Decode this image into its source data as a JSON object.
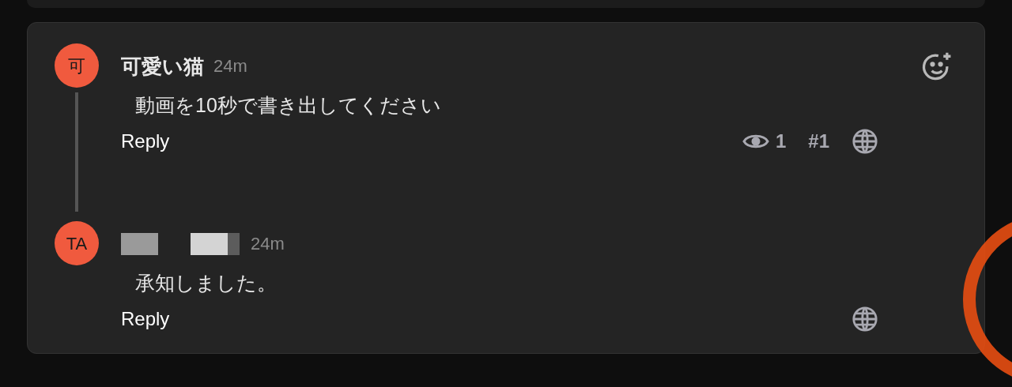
{
  "comments": [
    {
      "avatar": "可",
      "author": {
        "kind": "text",
        "name": "可愛い猫"
      },
      "time": "24m",
      "text": "動画を10秒で書き出してください",
      "reply_label": "Reply",
      "reaction_button": true,
      "views": "1",
      "number": "#1",
      "replies": [
        {
          "avatar": "TA",
          "author": {
            "kind": "redacted"
          },
          "time": "24m",
          "text": "承知しました。",
          "reply_label": "Reply",
          "reaction_button": false
        }
      ]
    }
  ]
}
